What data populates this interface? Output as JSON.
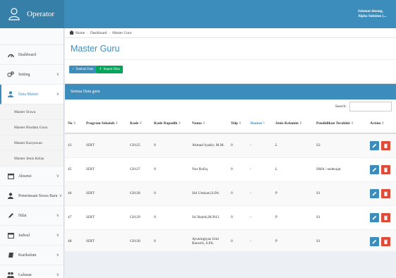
{
  "app": {
    "title": "Operator"
  },
  "header": {
    "welcome_line1": "Selamat datang,",
    "welcome_line2": "Alpha Solution (..."
  },
  "sidebar": {
    "items": [
      {
        "label": "Dashboard",
        "icon": "dashboard-icon"
      },
      {
        "label": "Setting",
        "icon": "gears-icon"
      },
      {
        "label": "Data Master",
        "icon": "user-icon"
      },
      {
        "label": "Absensi",
        "icon": "calendar-icon"
      },
      {
        "label": "Penerimaan Siswa Baru",
        "icon": "user-icon"
      },
      {
        "label": "Nilai",
        "icon": "pencil-icon"
      },
      {
        "label": "Jadwal",
        "icon": "calendar-icon"
      },
      {
        "label": "Kurikulum",
        "icon": "book-icon"
      },
      {
        "label": "Lulusan",
        "icon": "users-icon"
      }
    ],
    "submenu": [
      "Master Siswa",
      "Master Biodata Guru",
      "Master Karyawan",
      "Master Jenis Kelas"
    ]
  },
  "breadcrumb": {
    "home": "Home",
    "dashboard": "Dashboard",
    "current": "Master Guru"
  },
  "page": {
    "title": "Master Guru"
  },
  "actions": {
    "add_label": "Tambah Data",
    "import_label": "Import Data"
  },
  "table_box": {
    "title": "Semua Data guru",
    "search_label": "Search:"
  },
  "table": {
    "headers": [
      "No",
      "Program Sekolah",
      "Kode",
      "Kode Dapodik",
      "Nama",
      "Telp",
      "Alamat",
      "Jenis Kelamin",
      "Pendidikan Terakhir",
      "Action"
    ],
    "rows": [
      {
        "no": "43",
        "program": "SDIT",
        "kode": "G0125",
        "dapodik": "0",
        "nama": "Ahmad Syakir, M.M.",
        "telp": "0",
        "alamat": "-",
        "jk": "L",
        "pendidikan": "S2"
      },
      {
        "no": "45",
        "program": "SDIT",
        "kode": "G0127",
        "dapodik": "0",
        "nama": "Nur Rofiq",
        "telp": "0",
        "alamat": "-",
        "jk": "L",
        "pendidikan": "SMA / sederajat"
      },
      {
        "no": "46",
        "program": "SDIT",
        "kode": "G0128",
        "dapodik": "0",
        "nama": "Siti Umisari,S.Pd.",
        "telp": "0",
        "alamat": "-",
        "jk": "P",
        "pendidikan": "S1"
      },
      {
        "no": "47",
        "program": "SDIT",
        "kode": "G0129",
        "dapodik": "0",
        "nama": "Sri Rejeki,M.Pd.I",
        "telp": "0",
        "alamat": "-",
        "jk": "P",
        "pendidikan": "S1"
      },
      {
        "no": "48",
        "program": "SDIT",
        "kode": "G0130",
        "dapodik": "0",
        "nama": "Ayuningtyas Umi Barorrh, S.Pd.",
        "telp": "0",
        "alamat": "-",
        "jk": "P",
        "pendidikan": "S1"
      }
    ]
  },
  "colors": {
    "primary": "#3c8dbc",
    "brand": "#367fa9",
    "success": "#00a65a",
    "danger": "#dd4b39"
  }
}
